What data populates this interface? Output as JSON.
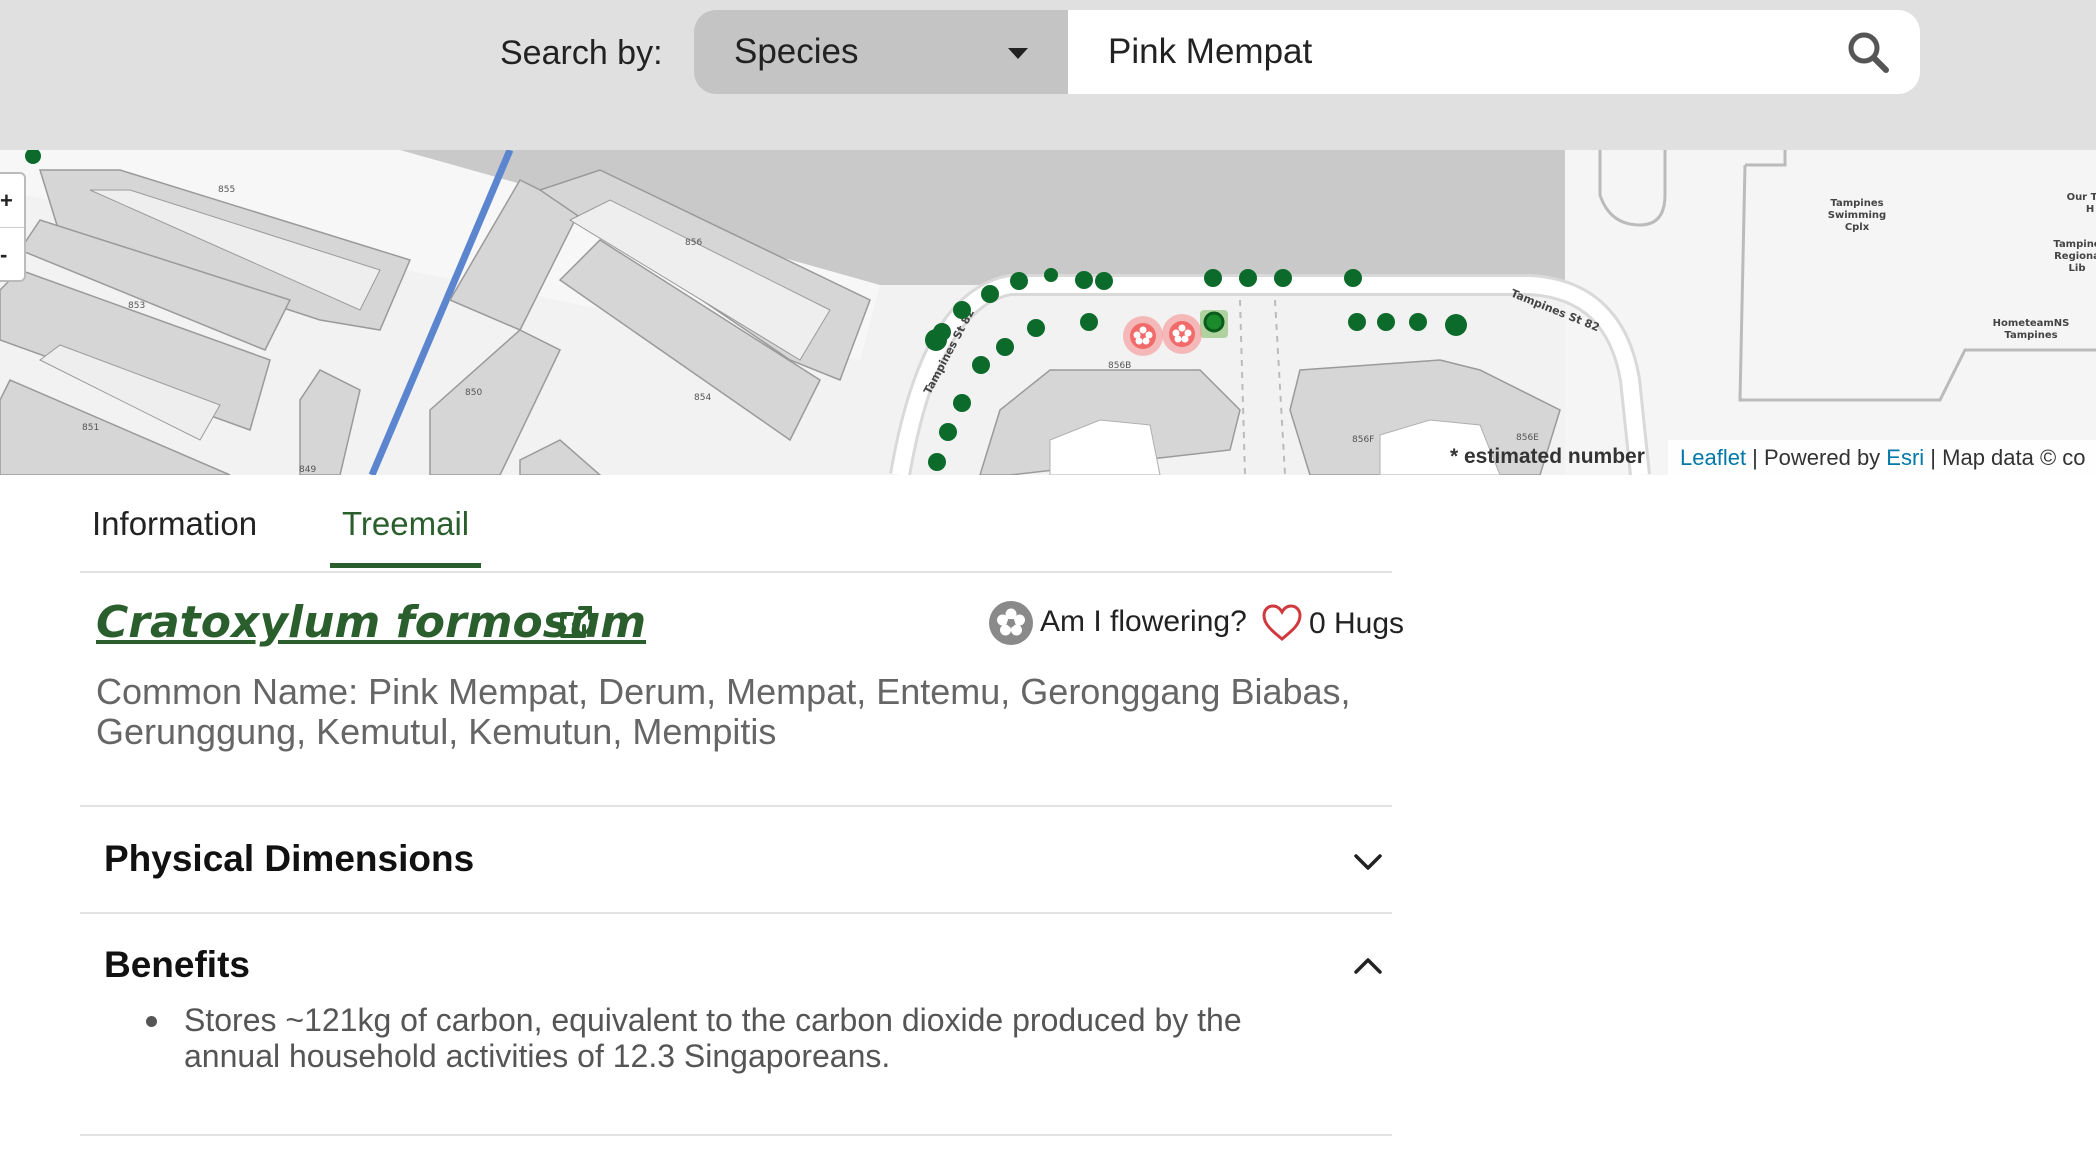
{
  "search": {
    "label": "Search by:",
    "mode": "Species",
    "query": "Pink Mempat"
  },
  "map": {
    "street_labels": [
      "Tampines St 82",
      "Tampines St 82"
    ],
    "block_labels": [
      "855",
      "856",
      "853",
      "850",
      "854",
      "851",
      "849",
      "856B",
      "856F",
      "856E"
    ],
    "poi_labels": [
      [
        "Tampines",
        "Swimming",
        "Cplx"
      ],
      [
        "Our T",
        "H"
      ],
      [
        "Tampine",
        "Regiona",
        "Lib"
      ],
      [
        "HometeamNS",
        "Tampines"
      ]
    ],
    "zoom_in": "+",
    "zoom_out": "-",
    "estimated_note": "* estimated number",
    "attribution": {
      "leaflet": "Leaflet",
      "sep1": " | Powered by ",
      "esri": "Esri",
      "sep2": " | Map data © co"
    }
  },
  "tabs": [
    {
      "label": "Information",
      "active": false
    },
    {
      "label": "Treemail",
      "active": true
    }
  ],
  "species": {
    "scientific_name": "Cratoxylum formosum",
    "flowering_label": "Am I flowering?",
    "hugs_label": "0 Hugs",
    "common_name": "Common Name: Pink Mempat, Derum, Mempat, Entemu, Geronggang Biabas, Gerunggung, Kemutul, Kemutun, Mempitis"
  },
  "sections": [
    {
      "title": "Physical Dimensions",
      "expanded": false
    },
    {
      "title": "Benefits",
      "expanded": true
    }
  ],
  "benefits": [
    "Stores ~121kg of carbon, equivalent to the carbon dioxide produced by the annual household activities of 12.3 Singaporeans."
  ],
  "colors": {
    "brand_green": "#2a5f2d",
    "tree_marker": "#0c6b2a",
    "flowering_marker": "#f26b6b",
    "heart": "#d0393e"
  }
}
